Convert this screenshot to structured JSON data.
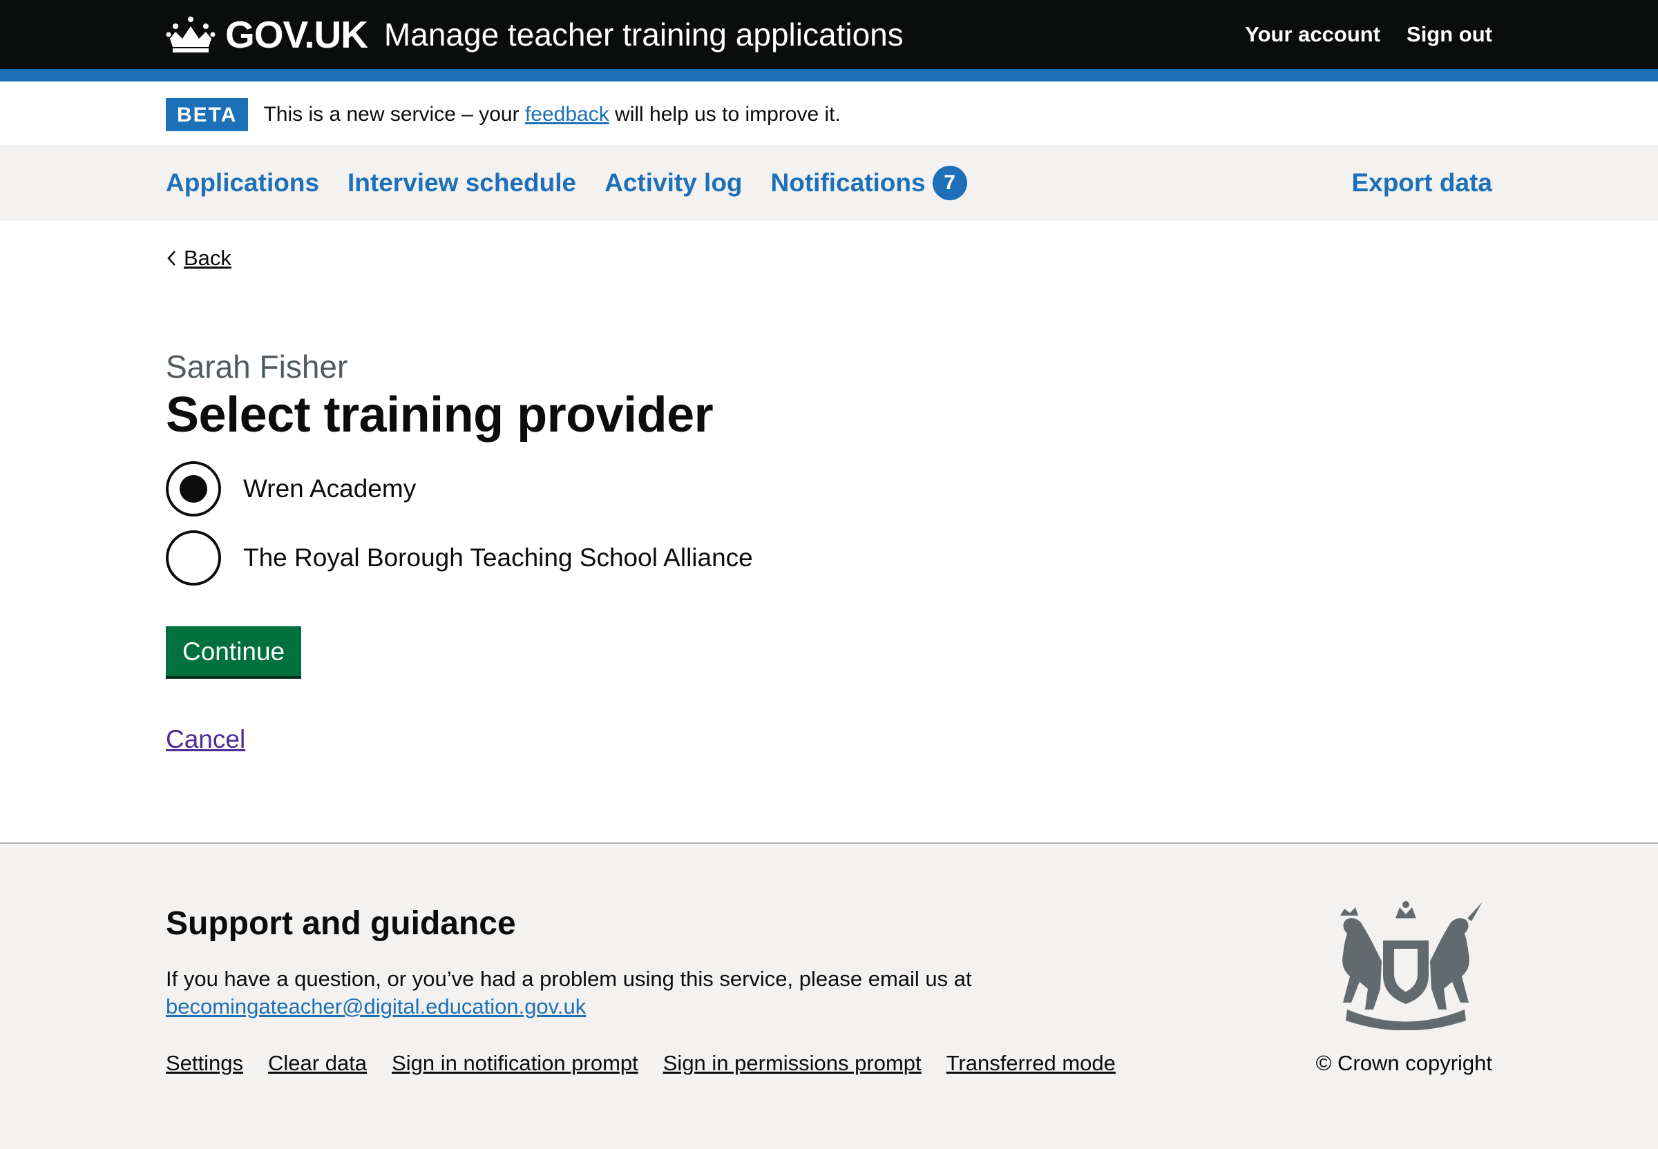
{
  "header": {
    "logo_text": "GOV.UK",
    "service_name": "Manage teacher training applications",
    "account_link": "Your account",
    "signout_link": "Sign out"
  },
  "phase_banner": {
    "tag": "BETA",
    "text_before": "This is a new service – your ",
    "feedback_link": "feedback",
    "text_after": " will help us to improve it."
  },
  "primary_nav": {
    "items": [
      {
        "label": "Applications"
      },
      {
        "label": "Interview schedule"
      },
      {
        "label": "Activity log"
      },
      {
        "label": "Notifications",
        "count": "7"
      }
    ],
    "export_label": "Export data"
  },
  "main": {
    "back_label": "Back",
    "caption": "Sarah Fisher",
    "title": "Select training provider",
    "options": [
      {
        "label": "Wren Academy",
        "selected": true
      },
      {
        "label": "The Royal Borough Teaching School Alliance",
        "selected": false
      }
    ],
    "continue_label": "Continue",
    "cancel_label": "Cancel"
  },
  "footer": {
    "heading": "Support and guidance",
    "text": "If you have a question, or you’ve had a problem using this service, please email us at",
    "email": "becomingateacher@digital.education.gov.uk",
    "links": [
      "Settings",
      "Clear data",
      "Sign in notification prompt",
      "Sign in permissions prompt",
      "Transferred mode"
    ],
    "copyright": "© Crown copyright"
  },
  "colors": {
    "header_bg": "#0b0c0c",
    "brand_blue": "#1d70b8",
    "button_green": "#00703c",
    "footer_bg": "#f3f2f1",
    "visited_link": "#4c2c92"
  }
}
